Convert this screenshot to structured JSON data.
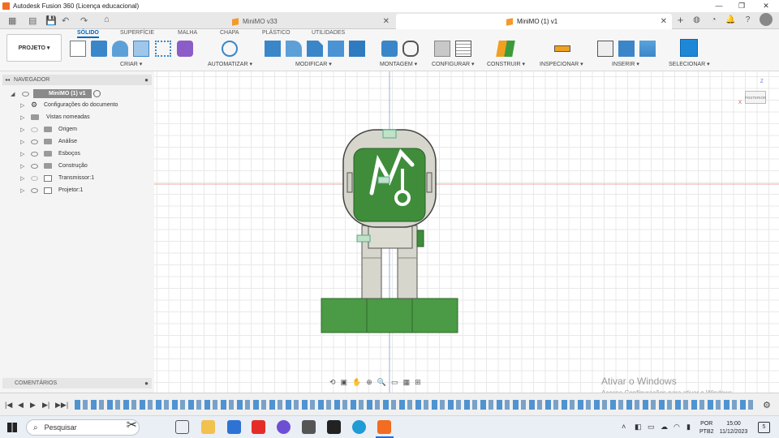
{
  "window": {
    "title": "Autodesk Fusion 360 (Licença educacional)"
  },
  "tabs": [
    {
      "label": "MiniMO v33"
    },
    {
      "label": "MiniMO (1) v1"
    }
  ],
  "toolbar": {
    "projeto_label": "PROJETO ▾",
    "workspaces": [
      "SÓLIDO",
      "SUPERFÍCIE",
      "MALHA",
      "CHAPA",
      "PLÁSTICO",
      "UTILIDADES"
    ],
    "groups": [
      "CRIAR ▾",
      "AUTOMATIZAR ▾",
      "MODIFICAR ▾",
      "MONTAGEM ▾",
      "CONFIGURAR ▾",
      "CONSTRUIR ▾",
      "INSPECIONAR ▾",
      "INSERIR ▾",
      "SELECIONAR ▾"
    ]
  },
  "navigator": {
    "header": "NAVEGADOR",
    "root": "MiniMO (1) v1",
    "items": [
      {
        "label": "Configurações do documento"
      },
      {
        "label": "Vistas nomeadas"
      },
      {
        "label": "Origem"
      },
      {
        "label": "Análise"
      },
      {
        "label": "Esboços"
      },
      {
        "label": "Construção"
      },
      {
        "label": "Transmissor:1"
      },
      {
        "label": "Projetor:1"
      }
    ]
  },
  "comments": {
    "label": "COMENTÁRIOS"
  },
  "viewcube": {
    "face": "POSTERIOR",
    "axis_z": "Z",
    "axis_x": "X"
  },
  "watermark": {
    "line1": "Ativar o Windows",
    "line2": "Acesse Configurações para ativar o Windows."
  },
  "taskbar": {
    "search_placeholder": "Pesquisar",
    "lang1": "POR",
    "lang2": "PTB2",
    "time": "15:00",
    "date": "11/12/2023",
    "notification_count": "5"
  },
  "colors": {
    "accent": "#0067c0",
    "model_green": "#3f8d3b",
    "model_base_green": "#4b9a45",
    "model_gray": "#d6d6cc",
    "fusion_orange": "#f26c21"
  }
}
